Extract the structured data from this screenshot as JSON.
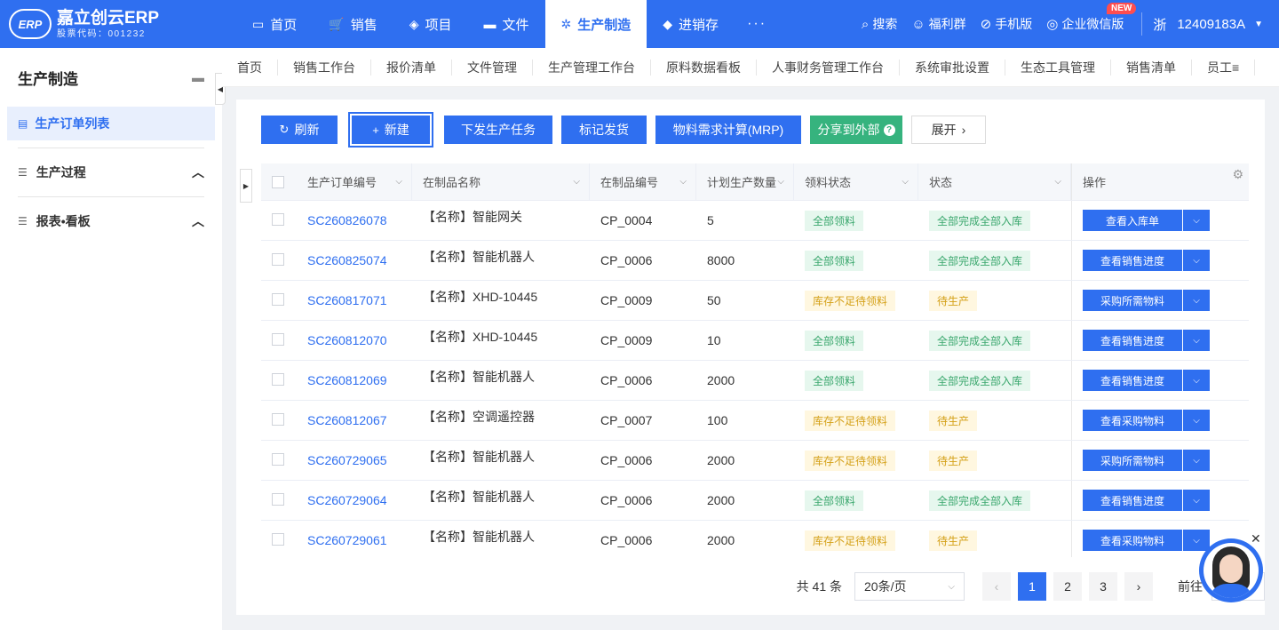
{
  "brand": {
    "name": "嘉立创云ERP",
    "code": "股票代码：001232",
    "logo_text": "ERP"
  },
  "nav": [
    {
      "label": "首页",
      "icon": "monitor-icon",
      "glyph": "▭",
      "active": false
    },
    {
      "label": "销售",
      "icon": "cart-icon",
      "glyph": "🛒",
      "active": false
    },
    {
      "label": "项目",
      "icon": "layers-icon",
      "glyph": "◈",
      "active": false
    },
    {
      "label": "文件",
      "icon": "folder-icon",
      "glyph": "▬",
      "active": false
    },
    {
      "label": "生产制造",
      "icon": "gear-icon",
      "glyph": "✲",
      "active": true
    },
    {
      "label": "进销存",
      "icon": "box-icon",
      "glyph": "◆",
      "active": false
    }
  ],
  "nav_more": "···",
  "tools": {
    "search": "搜索",
    "welfare": "福利群",
    "mobile": "手机版",
    "wecom": "企业微信版",
    "new_badge": "NEW"
  },
  "user": {
    "province": "浙",
    "id": "12409183A"
  },
  "sidebar": {
    "title": "生产制造",
    "active_item": "生产订单列表",
    "groups": [
      "生产过程",
      "报表•看板"
    ]
  },
  "tabs": [
    "首页",
    "销售工作台",
    "报价清单",
    "文件管理",
    "生产管理工作台",
    "原料数据看板",
    "人事财务管理工作台",
    "系统审批设置",
    "生态工具管理",
    "销售清单",
    "员工≡"
  ],
  "toolbar": {
    "refresh": "刷新",
    "new": "新建",
    "dispatch": "下发生产任务",
    "mark_ship": "标记发货",
    "mrp": "物料需求计算(MRP)",
    "share": "分享到外部",
    "expand": "展开"
  },
  "table": {
    "columns": [
      "生产订单编号",
      "在制品名称",
      "在制品编号",
      "计划生产数量",
      "领料状态",
      "状态",
      "操作"
    ],
    "rows": [
      {
        "order": "SC260826078",
        "name": "【名称】智能网关",
        "code": "CP_0004",
        "qty": "5",
        "pick": "全部领料",
        "pick_color": "green",
        "status": "全部完成全部入库",
        "status_color": "green",
        "op": "查看入库单"
      },
      {
        "order": "SC260825074",
        "name": "【名称】智能机器人",
        "code": "CP_0006",
        "qty": "8000",
        "pick": "全部领料",
        "pick_color": "green",
        "status": "全部完成全部入库",
        "status_color": "green",
        "op": "查看销售进度"
      },
      {
        "order": "SC260817071",
        "name": "【名称】XHD-10445",
        "code": "CP_0009",
        "qty": "50",
        "pick": "库存不足待领料",
        "pick_color": "yellow",
        "status": "待生产",
        "status_color": "yellow",
        "op": "采购所需物料"
      },
      {
        "order": "SC260812070",
        "name": "【名称】XHD-10445",
        "code": "CP_0009",
        "qty": "10",
        "pick": "全部领料",
        "pick_color": "green",
        "status": "全部完成全部入库",
        "status_color": "green",
        "op": "查看销售进度"
      },
      {
        "order": "SC260812069",
        "name": "【名称】智能机器人",
        "code": "CP_0006",
        "qty": "2000",
        "pick": "全部领料",
        "pick_color": "green",
        "status": "全部完成全部入库",
        "status_color": "green",
        "op": "查看销售进度"
      },
      {
        "order": "SC260812067",
        "name": "【名称】空调遥控器",
        "code": "CP_0007",
        "qty": "100",
        "pick": "库存不足待领料",
        "pick_color": "yellow",
        "status": "待生产",
        "status_color": "yellow",
        "op": "查看采购物料"
      },
      {
        "order": "SC260729065",
        "name": "【名称】智能机器人",
        "code": "CP_0006",
        "qty": "2000",
        "pick": "库存不足待领料",
        "pick_color": "yellow",
        "status": "待生产",
        "status_color": "yellow",
        "op": "采购所需物料"
      },
      {
        "order": "SC260729064",
        "name": "【名称】智能机器人",
        "code": "CP_0006",
        "qty": "2000",
        "pick": "全部领料",
        "pick_color": "green",
        "status": "全部完成全部入库",
        "status_color": "green",
        "op": "查看销售进度"
      },
      {
        "order": "SC260729061",
        "name": "【名称】智能机器人",
        "code": "CP_0006",
        "qty": "2000",
        "pick": "库存不足待领料",
        "pick_color": "yellow",
        "status": "待生产",
        "status_color": "yellow",
        "op": "查看采购物料"
      }
    ]
  },
  "pagination": {
    "total": "共 41 条",
    "page_size": "20条/页",
    "pages": [
      "1",
      "2",
      "3"
    ],
    "current": "1",
    "goto": "前往"
  },
  "colors": {
    "primary": "#2f6ff0",
    "green": "#36b37e",
    "tag_green": "#3aa76d",
    "tag_yellow": "#d4a017"
  }
}
